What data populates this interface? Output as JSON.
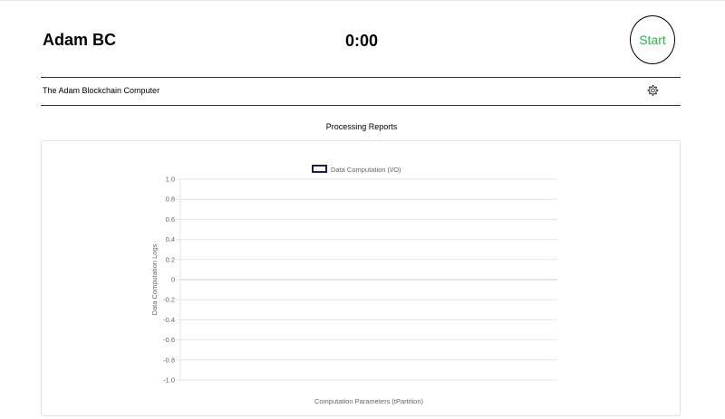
{
  "header": {
    "app_title": "Adam BC",
    "timer": "0:00",
    "start_label": "Start"
  },
  "subheader": {
    "subtitle": "The Adam Blockchain Computer",
    "settings_icon": "gear-icon"
  },
  "section": {
    "title": "Processing Reports"
  },
  "colors": {
    "start_text": "#22bb44",
    "series_border": "#1a1f5c",
    "grid": "#e6e6e6",
    "zero_line": "#cccccc"
  },
  "chart_data": {
    "type": "line",
    "title": "",
    "xlabel": "Computation Parameters (tPartition)",
    "ylabel": "Data Computation Logs",
    "ylim": [
      -1.0,
      1.0
    ],
    "yticks": [
      "1.0",
      "0.8",
      "0.6",
      "0.4",
      "0.2",
      "0",
      "-0.2",
      "-0.4",
      "-0.6",
      "-0.8",
      "-1.0"
    ],
    "categories": [],
    "series": [
      {
        "name": "Data Computation (I/O)",
        "values": []
      }
    ],
    "legend": "top-center",
    "grid": true
  }
}
